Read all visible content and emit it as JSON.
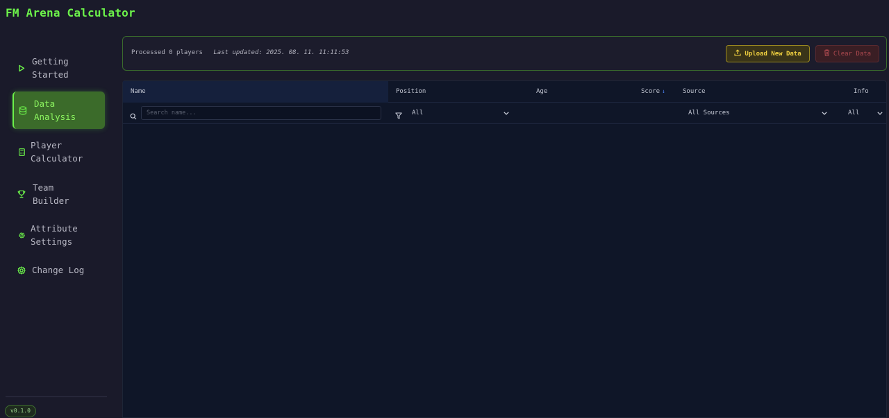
{
  "app": {
    "title": "FM Arena Calculator",
    "version": "v0.1.0"
  },
  "sidebar": {
    "items": [
      {
        "label_1": "Getting",
        "label_2": "Started",
        "icon": "play-icon"
      },
      {
        "label_1": "Data",
        "label_2": "Analysis",
        "icon": "database-icon",
        "active": true
      },
      {
        "label_1": "Player",
        "label_2": "Calculator",
        "icon": "calculator-icon"
      },
      {
        "label_1": "Team",
        "label_2": "Builder",
        "icon": "trophy-icon"
      },
      {
        "label_1": "Attribute",
        "label_2": "Settings",
        "icon": "gear-icon"
      },
      {
        "label_1": "Change Log",
        "icon": "gear-icon"
      }
    ]
  },
  "status": {
    "processed": "Processed 0 players",
    "last_updated": "Last updated: 2025. 08. 11. 11:11:53",
    "upload_label": "Upload New Data",
    "clear_label": "Clear Data"
  },
  "table": {
    "columns": {
      "name": "Name",
      "position": "Position",
      "age": "Age",
      "score": "Score",
      "source": "Source",
      "info": "Info"
    },
    "filters": {
      "search_placeholder": "Search name...",
      "position": "All",
      "source": "All Sources",
      "info": "All"
    },
    "rows": []
  },
  "colors": {
    "accent": "#6cf24a",
    "upload": "#f0d040",
    "clear": "#b04a50",
    "sort": "#4a80f0"
  }
}
